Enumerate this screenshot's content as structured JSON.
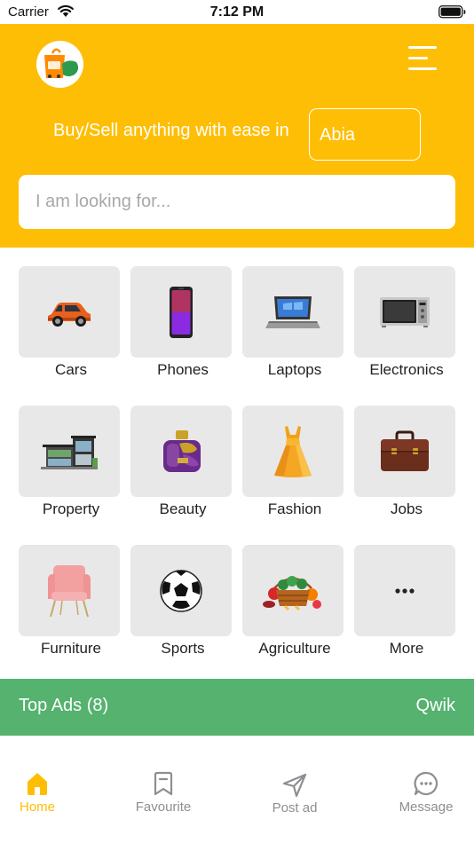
{
  "status_bar": {
    "carrier": "Carrier",
    "time": "7:12 PM"
  },
  "header": {
    "logo_icon": "qwik-shopping-bag-logo",
    "menu_icon": "hamburger-menu-icon",
    "tagline": "Buy/Sell anything with ease in",
    "state": "Abia",
    "search_placeholder": "I am looking for...",
    "background_color": "#FEBE05"
  },
  "categories": [
    {
      "label": "Cars",
      "icon": "car-icon"
    },
    {
      "label": "Phones",
      "icon": "phone-icon"
    },
    {
      "label": "Laptops",
      "icon": "laptop-icon"
    },
    {
      "label": "Electronics",
      "icon": "microwave-icon"
    },
    {
      "label": "Property",
      "icon": "building-icon"
    },
    {
      "label": "Beauty",
      "icon": "perfume-icon"
    },
    {
      "label": "Fashion",
      "icon": "dress-icon"
    },
    {
      "label": "Jobs",
      "icon": "briefcase-icon"
    },
    {
      "label": "Furniture",
      "icon": "chair-icon"
    },
    {
      "label": "Sports",
      "icon": "football-icon"
    },
    {
      "label": "Agriculture",
      "icon": "produce-basket-icon"
    },
    {
      "label": "More",
      "icon": "more-dots-icon"
    }
  ],
  "top_ads": {
    "title": "Top Ads (8)",
    "link": "Qwik",
    "background_color": "#55B26F"
  },
  "bottom_nav": {
    "active_color": "#FEBE05",
    "items": [
      {
        "label": "Home",
        "icon": "home-icon",
        "active": true
      },
      {
        "label": "Favourite",
        "icon": "bookmark-icon",
        "active": false
      },
      {
        "label": "Post ad",
        "icon": "send-icon",
        "active": false
      },
      {
        "label": "Message",
        "icon": "chat-bubble-icon",
        "active": false
      }
    ]
  }
}
